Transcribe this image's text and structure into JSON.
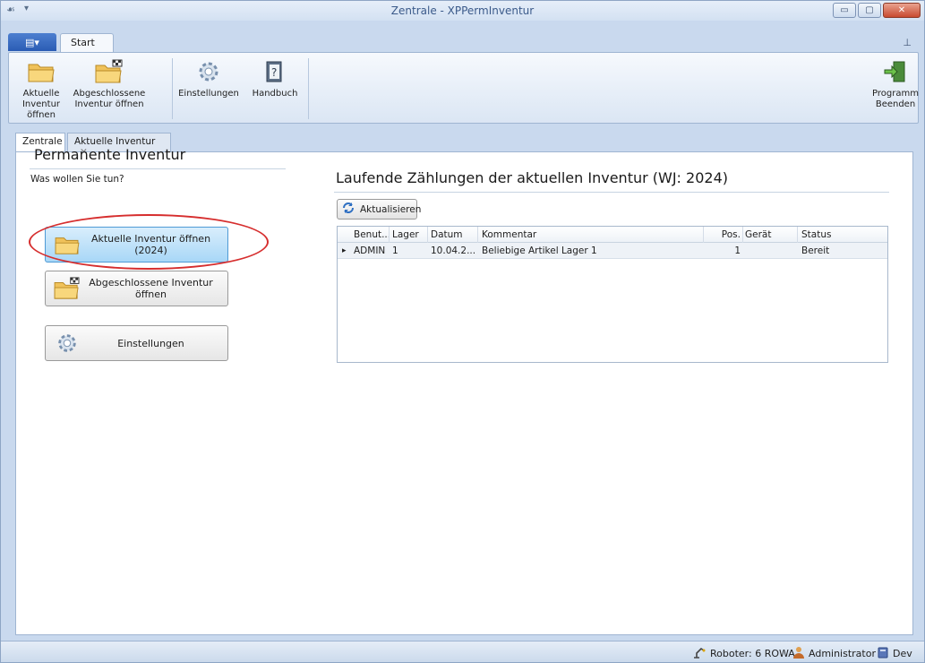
{
  "window": {
    "title": "Zentrale - XPPermInventur",
    "minimize_glyph": "▭",
    "maximize_glyph": "▢",
    "close_glyph": "✕"
  },
  "quick_access": {
    "icon": "☙",
    "arrow": "▾"
  },
  "ribbon": {
    "app_menu_label": "▤▾",
    "tab_start": "Start",
    "pin_glyph": "⊥",
    "buttons": [
      {
        "label_line1": "Aktuelle",
        "label_line2": "Inventur öffnen",
        "icon": "folder-icon"
      },
      {
        "label_line1": "Abgeschlossene",
        "label_line2": "Inventur öffnen",
        "icon": "folder-flag-icon"
      },
      {
        "label_line1": "Einstellungen",
        "label_line2": "",
        "icon": "gear-icon"
      },
      {
        "label_line1": "Handbuch",
        "label_line2": "",
        "icon": "book-icon"
      }
    ],
    "exit_button": {
      "label_line1": "Programm",
      "label_line2": "Beenden",
      "icon": "exit-door-icon"
    }
  },
  "doc_tabs": [
    {
      "label": "Zentrale",
      "active": true
    },
    {
      "label": "Aktuelle Inventur",
      "active": false,
      "close": "✕"
    }
  ],
  "left_panel": {
    "title": "Permanente Inventur",
    "question": "Was wollen Sie tun?",
    "buttons": [
      {
        "label": "Aktuelle Inventur öffnen (2024)",
        "icon": "folder-icon"
      },
      {
        "label": "Abgeschlossene Inventur öffnen",
        "icon": "folder-flag-icon"
      },
      {
        "label": "Einstellungen",
        "icon": "gear-icon"
      }
    ]
  },
  "right_panel": {
    "title": "Laufende Zählungen der aktuellen Inventur (WJ: 2024)",
    "refresh_label": "Aktualisieren",
    "columns": [
      "Benut...",
      "Lager",
      "Datum",
      "Kommentar",
      "Pos.",
      "Gerät",
      "Status"
    ],
    "rows": [
      {
        "indicator": "▸",
        "benutzer": "ADMIN",
        "lager": "1",
        "datum": "10.04.2...",
        "kommentar": "Beliebige Artikel Lager 1",
        "pos": "1",
        "geraet": "",
        "status": "Bereit"
      }
    ]
  },
  "statusbar": {
    "roboter": "Roboter: 6 ROWA",
    "user": "Administrator",
    "db": "Dev"
  },
  "colors": {
    "accent": "#2a5cb4",
    "highlight_ellipse": "#d62e2e",
    "focused_button": "#a8d7f7"
  }
}
